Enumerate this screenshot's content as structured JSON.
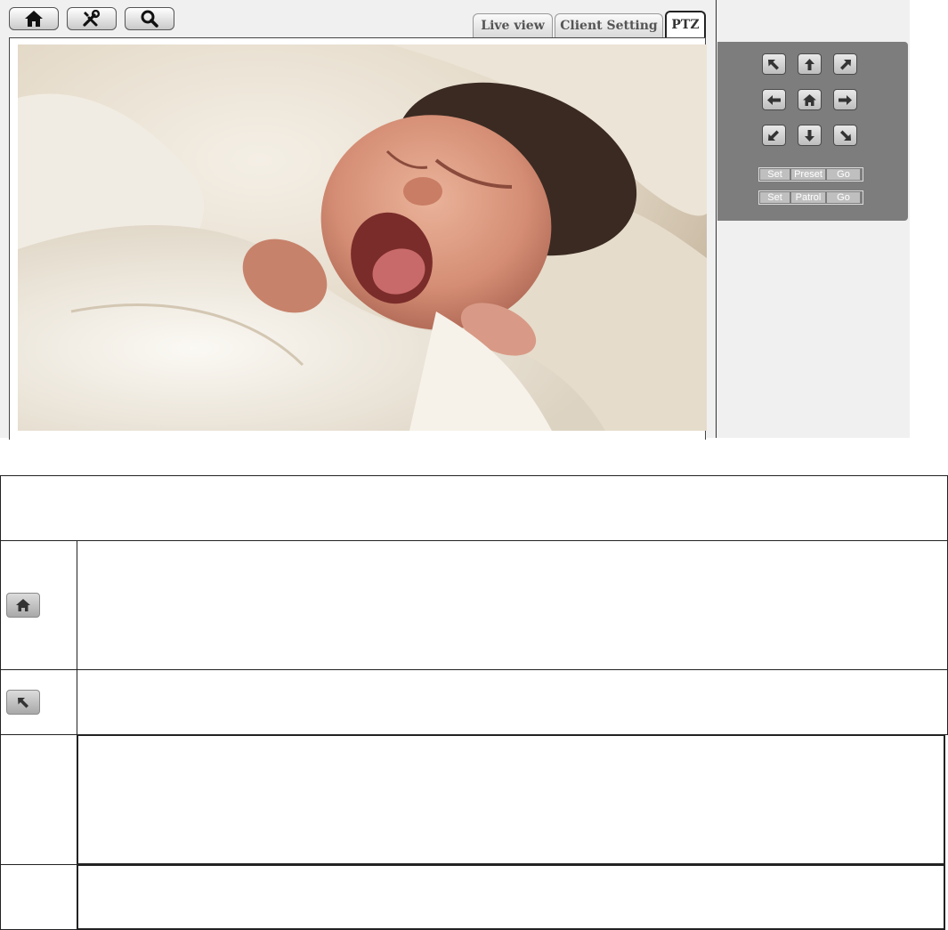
{
  "toolbar": {
    "home_icon": "home-icon",
    "tools_icon": "tools-icon",
    "search_icon": "search-icon"
  },
  "tabs": [
    {
      "label": "Live view",
      "active": false
    },
    {
      "label": "Client Setting",
      "active": false
    },
    {
      "label": "PTZ",
      "active": true
    }
  ],
  "viewer": {
    "content": "live-video-stream"
  },
  "ptz": {
    "direction_icons": [
      "arrow-up-left-icon",
      "arrow-up-icon",
      "arrow-up-right-icon",
      "arrow-left-icon",
      "home-icon",
      "arrow-right-icon",
      "arrow-down-left-icon",
      "arrow-down-icon",
      "arrow-down-right-icon"
    ],
    "preset": {
      "set": "Set",
      "label": "Preset",
      "go": "Go"
    },
    "patrol": {
      "set": "Set",
      "label": "Patrol",
      "go": "Go"
    }
  },
  "legend": {
    "rows": [
      {
        "icon": "",
        "text": ""
      },
      {
        "icon": "home-icon",
        "text": ""
      },
      {
        "icon": "arrow-up-left-icon",
        "text": ""
      },
      {
        "icon": "",
        "text": ""
      },
      {
        "icon": "",
        "text": ""
      }
    ]
  },
  "colors": {
    "panel_bg": "#f0f0f0",
    "ptz_panel": "#7d7d7d",
    "button_gradient_top": "#ffffff",
    "button_gradient_bottom": "#c9c9c9"
  }
}
